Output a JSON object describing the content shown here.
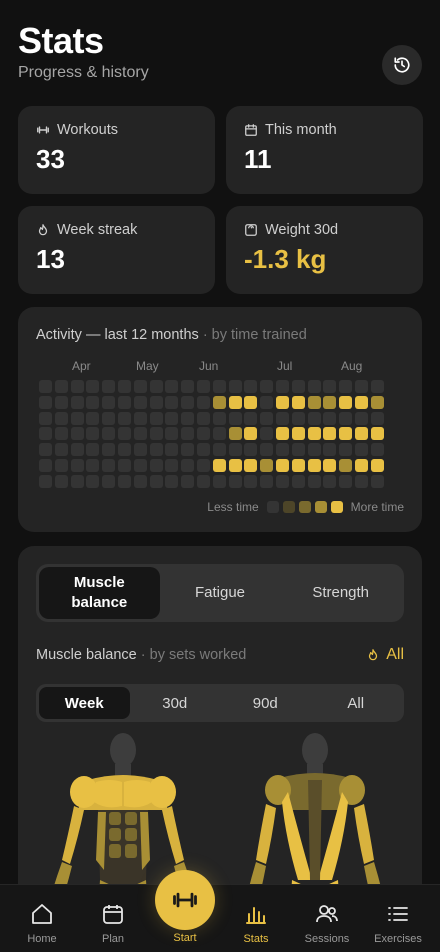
{
  "header": {
    "title": "Stats",
    "subtitle": "Progress & history"
  },
  "stats": [
    {
      "label": "Workouts",
      "value": "33",
      "icon": "dumbbell-icon"
    },
    {
      "label": "This month",
      "value": "11",
      "icon": "calendar-icon"
    },
    {
      "label": "Week streak",
      "value": "13",
      "icon": "flame-icon"
    },
    {
      "label": "Weight 30d",
      "value": "-1.3 kg",
      "icon": "scale-icon"
    }
  ],
  "activity": {
    "title": "Activity — last 12 months",
    "subtitle": "· by time trained",
    "months": [
      "Apr",
      "May",
      "Jun",
      "Jul",
      "Aug"
    ],
    "legend_less": "Less time",
    "legend_more": "More time",
    "levels": [
      [
        0,
        0,
        0,
        0,
        0,
        0,
        0,
        0,
        0,
        0,
        0,
        0,
        0,
        0,
        0,
        0,
        0,
        0,
        0,
        0,
        0,
        0
      ],
      [
        0,
        0,
        0,
        0,
        0,
        0,
        0,
        0,
        0,
        0,
        0,
        3,
        4,
        4,
        0,
        4,
        4,
        3,
        3,
        4,
        4,
        3
      ],
      [
        0,
        0,
        0,
        0,
        0,
        0,
        0,
        0,
        0,
        0,
        0,
        0,
        0,
        0,
        0,
        0,
        0,
        0,
        0,
        0,
        0,
        0
      ],
      [
        0,
        0,
        0,
        0,
        0,
        0,
        0,
        0,
        0,
        0,
        0,
        0,
        3,
        4,
        0,
        4,
        4,
        4,
        4,
        4,
        4,
        4
      ],
      [
        0,
        0,
        0,
        0,
        0,
        0,
        0,
        0,
        0,
        0,
        0,
        0,
        0,
        0,
        0,
        0,
        0,
        0,
        0,
        0,
        0,
        0
      ],
      [
        0,
        0,
        0,
        0,
        0,
        0,
        0,
        0,
        0,
        0,
        0,
        4,
        4,
        4,
        3,
        4,
        4,
        4,
        4,
        3,
        4,
        4
      ],
      [
        0,
        0,
        0,
        0,
        0,
        0,
        0,
        0,
        0,
        0,
        0,
        0,
        0,
        0,
        0,
        0,
        0,
        0,
        0,
        0,
        0,
        0
      ]
    ],
    "colors": [
      "#343434",
      "#4d4528",
      "#7a6a2e",
      "#a88f35",
      "#e8c044"
    ]
  },
  "panel": {
    "tabs": [
      "Muscle balance",
      "Fatigue",
      "Strength"
    ],
    "active_tab": 0,
    "mb_title": "Muscle balance",
    "mb_sub": "· by sets worked",
    "mb_filter": "All",
    "ranges": [
      "Week",
      "30d",
      "90d",
      "All"
    ],
    "active_range": 0
  },
  "tabbar": {
    "items": [
      {
        "label": "Home",
        "icon": "home-icon"
      },
      {
        "label": "Plan",
        "icon": "calendar-icon"
      },
      {
        "label": "Start",
        "icon": "dumbbell-icon"
      },
      {
        "label": "Stats",
        "icon": "bar-chart-icon"
      },
      {
        "label": "Sessions",
        "icon": "users-icon"
      },
      {
        "label": "Exercises",
        "icon": "list-icon"
      }
    ],
    "active": 3
  },
  "accent": "#e8c044"
}
